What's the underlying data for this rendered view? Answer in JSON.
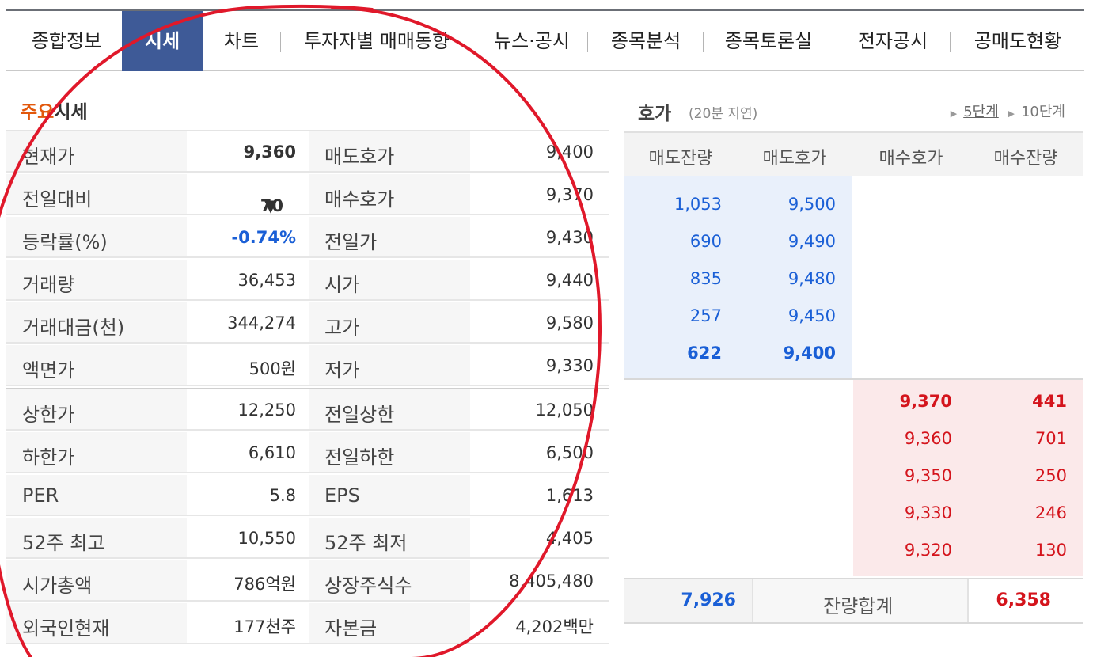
{
  "tabs": [
    "종합정보",
    "시세",
    "차트",
    "투자자별 매매동향",
    "뉴스·공시",
    "종목분석",
    "종목토론실",
    "전자공시",
    "공매도현황"
  ],
  "active_tab": "시세",
  "left": {
    "title_accent": "주요",
    "title_rest": "시세",
    "rows": [
      {
        "l1": "현재가",
        "v1": "9,360",
        "l2": "매도호가",
        "v2": "9,400"
      },
      {
        "l1": "전일대비",
        "v1": "70",
        "l2": "매수호가",
        "v2": "9,370"
      },
      {
        "l1": "등락률(%)",
        "v1": "-0.74%",
        "l2": "전일가",
        "v2": "9,430"
      },
      {
        "l1": "거래량",
        "v1": "36,453",
        "l2": "시가",
        "v2": "9,440"
      },
      {
        "l1": "거래대금(천)",
        "v1": "344,274",
        "l2": "고가",
        "v2": "9,580"
      },
      {
        "l1": "액면가",
        "v1": "500원",
        "l2": "저가",
        "v2": "9,330"
      },
      {
        "l1": "상한가",
        "v1": "12,250",
        "l2": "전일상한",
        "v2": "12,050"
      },
      {
        "l1": "하한가",
        "v1": "6,610",
        "l2": "전일하한",
        "v2": "6,500"
      },
      {
        "l1": "PER",
        "v1": "5.8",
        "l2": "EPS",
        "v2": "1,613"
      },
      {
        "l1": "52주 최고",
        "v1": "10,550",
        "l2": "52주 최저",
        "v2": "4,405"
      },
      {
        "l1": "시가총액",
        "v1": "786억원",
        "l2": "상장주식수",
        "v2": "8,405,480"
      },
      {
        "l1": "외국인현재",
        "v1": "177천주",
        "l2": "자본금",
        "v2": "4,202백만"
      }
    ],
    "change_direction_icon": "down-triangle-icon"
  },
  "orderbook": {
    "title": "호가",
    "delay": "(20분 지연)",
    "level_5": "5단계",
    "level_10": "10단계",
    "headers": [
      "매도잔량",
      "매도호가",
      "매수호가",
      "매수잔량"
    ],
    "asks": [
      {
        "qty": "1,053",
        "price": "9,500"
      },
      {
        "qty": "690",
        "price": "9,490"
      },
      {
        "qty": "835",
        "price": "9,480"
      },
      {
        "qty": "257",
        "price": "9,450"
      },
      {
        "qty": "622",
        "price": "9,400"
      }
    ],
    "bids": [
      {
        "price": "9,370",
        "qty": "441"
      },
      {
        "price": "9,360",
        "qty": "701"
      },
      {
        "price": "9,350",
        "qty": "250"
      },
      {
        "price": "9,330",
        "qty": "246"
      },
      {
        "price": "9,320",
        "qty": "130"
      }
    ],
    "total_ask": "7,926",
    "total_label": "잔량합계",
    "total_bid": "6,358"
  },
  "colors": {
    "accent_orange": "#e2580c",
    "tab_active": "#3e5a97",
    "blue": "#1a5fd6",
    "red": "#d4141c",
    "annotation": "#e0182a"
  }
}
